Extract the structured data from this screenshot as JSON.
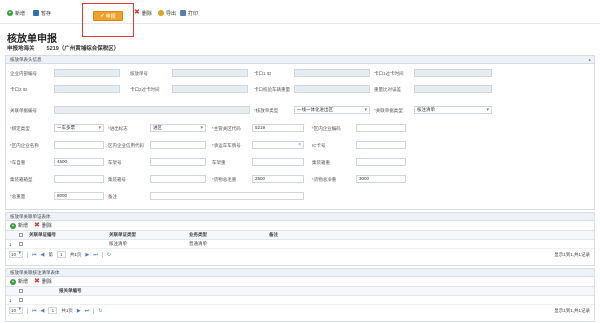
{
  "toolbar": {
    "add_label": "新增",
    "save_label": "暂存",
    "declare_label": "申报",
    "delete_label": "删除",
    "export_label": "导出",
    "print_label": "打印"
  },
  "page": {
    "title": "核放单申报",
    "customs_label": "申报地海关",
    "customs_value": "5219（广州黄埔综合保税区）"
  },
  "header_section": {
    "title": "核放单表头信息",
    "fields": {
      "enterprise_internal_no": "企业内部编号",
      "verify_no": "核放单号",
      "card1_id": "卡口1 ID",
      "card1_time": "卡口1过卡时间",
      "card2_id": "卡口2 ID",
      "card2_time": "卡口2过卡时间",
      "card_check_result": "卡口校验车辆重量",
      "weight_ratio": "重量比对误差",
      "related_doc_no": "关联单据编号",
      "verify_type": "核放单类型",
      "verify_type_value": "一线一体化进出区",
      "related_doc_type": "关联单据类型",
      "related_doc_type_value": "核注清单",
      "entry_type": "绑定类型",
      "entry_type_value": "一车多票",
      "io_flag": "进出标志",
      "io_flag_value": "进区",
      "customs_code": "主管关区代码",
      "customs_code_value": "5219",
      "area_enterprise_code": "区内企业编码",
      "area_enterprise_name": "区内企业名称",
      "area_social_code": "区内企业信用代码",
      "vehicle_no": "承运车车牌号",
      "ic_no": "IC卡号",
      "vehicle_weight": "车自重",
      "vehicle_weight_value": "4500",
      "frame_no": "车架号",
      "frame_weight": "车架重",
      "container_weight": "集装箱重",
      "container_type": "集装箱箱型",
      "container_no": "集装箱号",
      "total_gross": "货物总毛重",
      "total_gross_value": "2500",
      "total_net": "货物总净重",
      "total_net_value": "3000",
      "total_weight": "总重量",
      "total_weight_value": "8000",
      "remark": "备注"
    }
  },
  "related_section": {
    "title": "核放单关联单证表体",
    "add_label": "新增",
    "delete_label": "删除",
    "columns": [
      "关联单证编号",
      "关联单证类型",
      "业务类型",
      "备注"
    ],
    "rows": [
      {
        "index": "1",
        "doc_no": "",
        "doc_type": "核注清单",
        "biz_type": "普通清单",
        "remark": ""
      }
    ],
    "pager": {
      "size": "10",
      "page": "1",
      "total_pages": "共1页",
      "of_label": "第",
      "info": "显示1到1,共1记录"
    }
  },
  "second_section": {
    "title": "核放单关联核注清单表体",
    "add_label": "新增",
    "delete_label": "删除",
    "columns": [
      "报关单编号"
    ],
    "rows": [
      {
        "index": "1",
        "doc_no": ""
      }
    ],
    "pager": {
      "size": "10",
      "page": "1",
      "total_pages": "共1页",
      "info": "显示1到1,共1记录"
    }
  }
}
